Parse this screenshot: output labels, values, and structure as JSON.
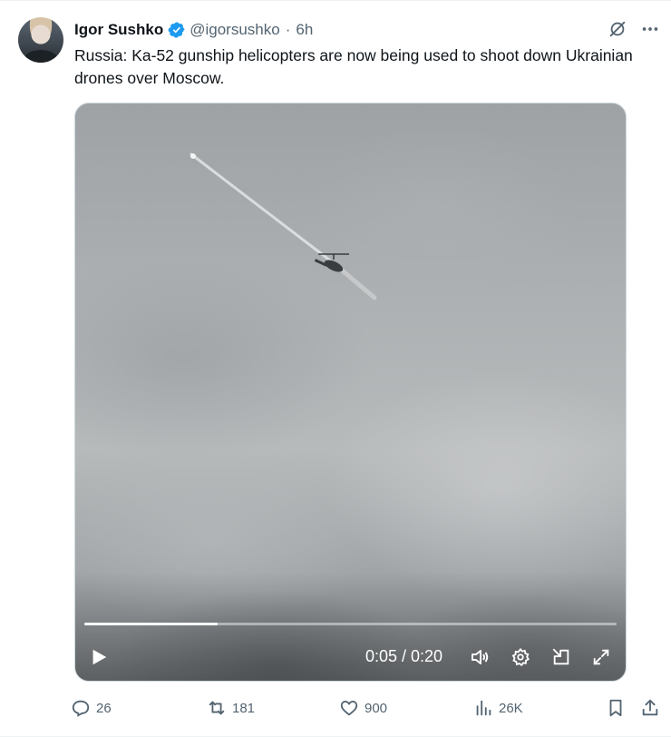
{
  "author": {
    "display_name": "Igor Sushko",
    "handle": "@igorsushko",
    "separator": "·",
    "time": "6h",
    "verified": true
  },
  "tweet": {
    "text": "Russia: Ka-52 gunship helicopters are now being used to shoot down Ukrainian drones over Moscow."
  },
  "top_icons": [
    "grok-icon",
    "more-icon"
  ],
  "video": {
    "progress": 0.25,
    "time_readout": "0:05 / 0:20",
    "controls": [
      "play-icon",
      "volume-icon",
      "settings-icon",
      "dock-icon",
      "fullscreen-icon"
    ]
  },
  "actions": {
    "replies": "26",
    "reposts": "181",
    "likes": "900",
    "views": "26K"
  },
  "colors": {
    "text_primary": "#0f1419",
    "text_secondary": "#536471",
    "verified_blue": "#1d9bf0",
    "border": "#cfd9de"
  }
}
